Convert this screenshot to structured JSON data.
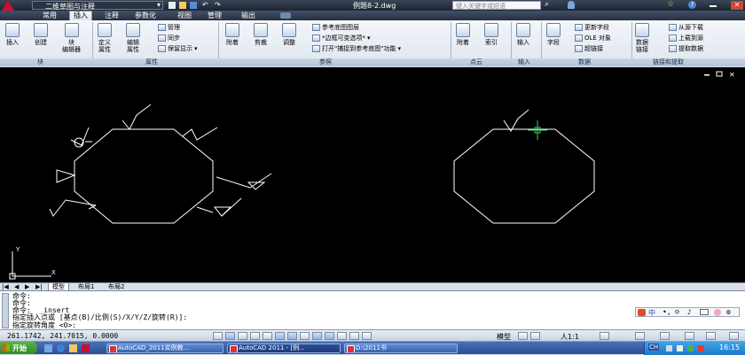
{
  "title_bar": {
    "workspace": "二维草图与注释",
    "document": "例题8-2.dwg",
    "search_placeholder": "键入关键字或短语"
  },
  "ribbon_tabs": [
    "常用",
    "插入",
    "注释",
    "参数化",
    "视图",
    "管理",
    "输出"
  ],
  "active_tab": "插入",
  "ribbon": {
    "block": {
      "insert": "插入",
      "create": "创建",
      "block_editor": "块\n编辑器",
      "panel": "块"
    },
    "attributes": {
      "define": "定义\n属性",
      "edit": "编辑\n属性",
      "manage": "管理",
      "sync": "同步",
      "keep_display": "保留显示",
      "panel": "属性"
    },
    "reference": {
      "attach": "附着",
      "clip": "剪裁",
      "adjust": "调整",
      "underlay_layers": "参考底图图层",
      "frame_variable": "*边框可变选项*",
      "snap_underlay": "打开\"捕捉到参考底图\"功能",
      "panel": "参照"
    },
    "point_cloud": {
      "attach": "附着",
      "index": "索引",
      "panel": "点云"
    },
    "import": {
      "import": "输入",
      "panel": "输入"
    },
    "data": {
      "field": "字段",
      "update_fields": "更新字段",
      "ole_object": "OLE 对象",
      "hyperlink": "超链接",
      "panel": "数据"
    },
    "linking": {
      "data_link": "数据\n链接",
      "download_source": "从源下载",
      "upload_source": "上载到源",
      "extract_data": "提取数据",
      "panel": "链接和提取"
    }
  },
  "layout_tabs": [
    "模型",
    "布局1",
    "布局2"
  ],
  "active_layout": "模型",
  "command_lines": [
    "命令:",
    "命令:",
    "命令:  _insert",
    "指定插入点或 [基点(B)/比例(S)/X/Y/Z/旋转(R)]:",
    "指定旋转角度 <0>:"
  ],
  "status": {
    "coordinates": "261.1742, 241.7015, 0.0000",
    "model_label": "模型",
    "annotation_scale": "人1:1"
  },
  "taskbar": {
    "start": "开始",
    "items": [
      "AutoCAD_2011实例教...",
      "AutoCAD 2011 - [例...",
      "D:\\2011书"
    ],
    "ime": "CH",
    "clock": "16:15"
  },
  "ime_bar": {
    "label": "中"
  }
}
